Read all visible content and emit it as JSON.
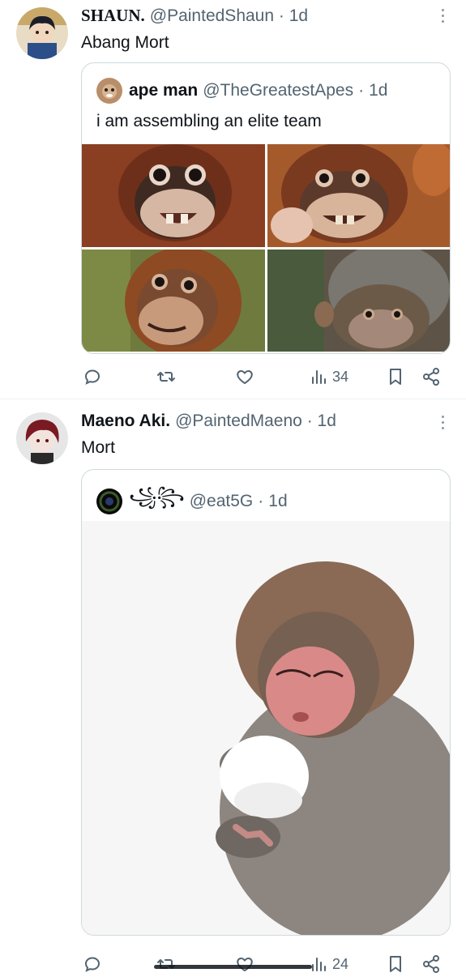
{
  "tweets": [
    {
      "display_name": "SHAUN.",
      "handle": "@PaintedShaun",
      "time": "1d",
      "text": "Abang Mort",
      "quote": {
        "display_name": "ape man",
        "handle": "@TheGreatestApes",
        "time": "1d",
        "text": "i am assembling an elite team",
        "media_count": 4
      },
      "actions": {
        "views": "34"
      }
    },
    {
      "display_name": "Maeno Aki.",
      "handle": "@PaintedMaeno",
      "time": "1d",
      "text": "Mort",
      "quote": {
        "display_name_glyphs": "꧁꧂",
        "handle": "@eat5G",
        "time": "1d",
        "media_count": 1
      },
      "actions": {
        "views": "24"
      }
    }
  ],
  "separator": "·",
  "icons": [
    "reply-icon",
    "retweet-icon",
    "like-icon",
    "views-icon",
    "bookmark-icon",
    "share-icon",
    "more-icon"
  ],
  "colors": {
    "text": "#0f1419",
    "secondary": "#536471",
    "border": "#cfd9de"
  }
}
